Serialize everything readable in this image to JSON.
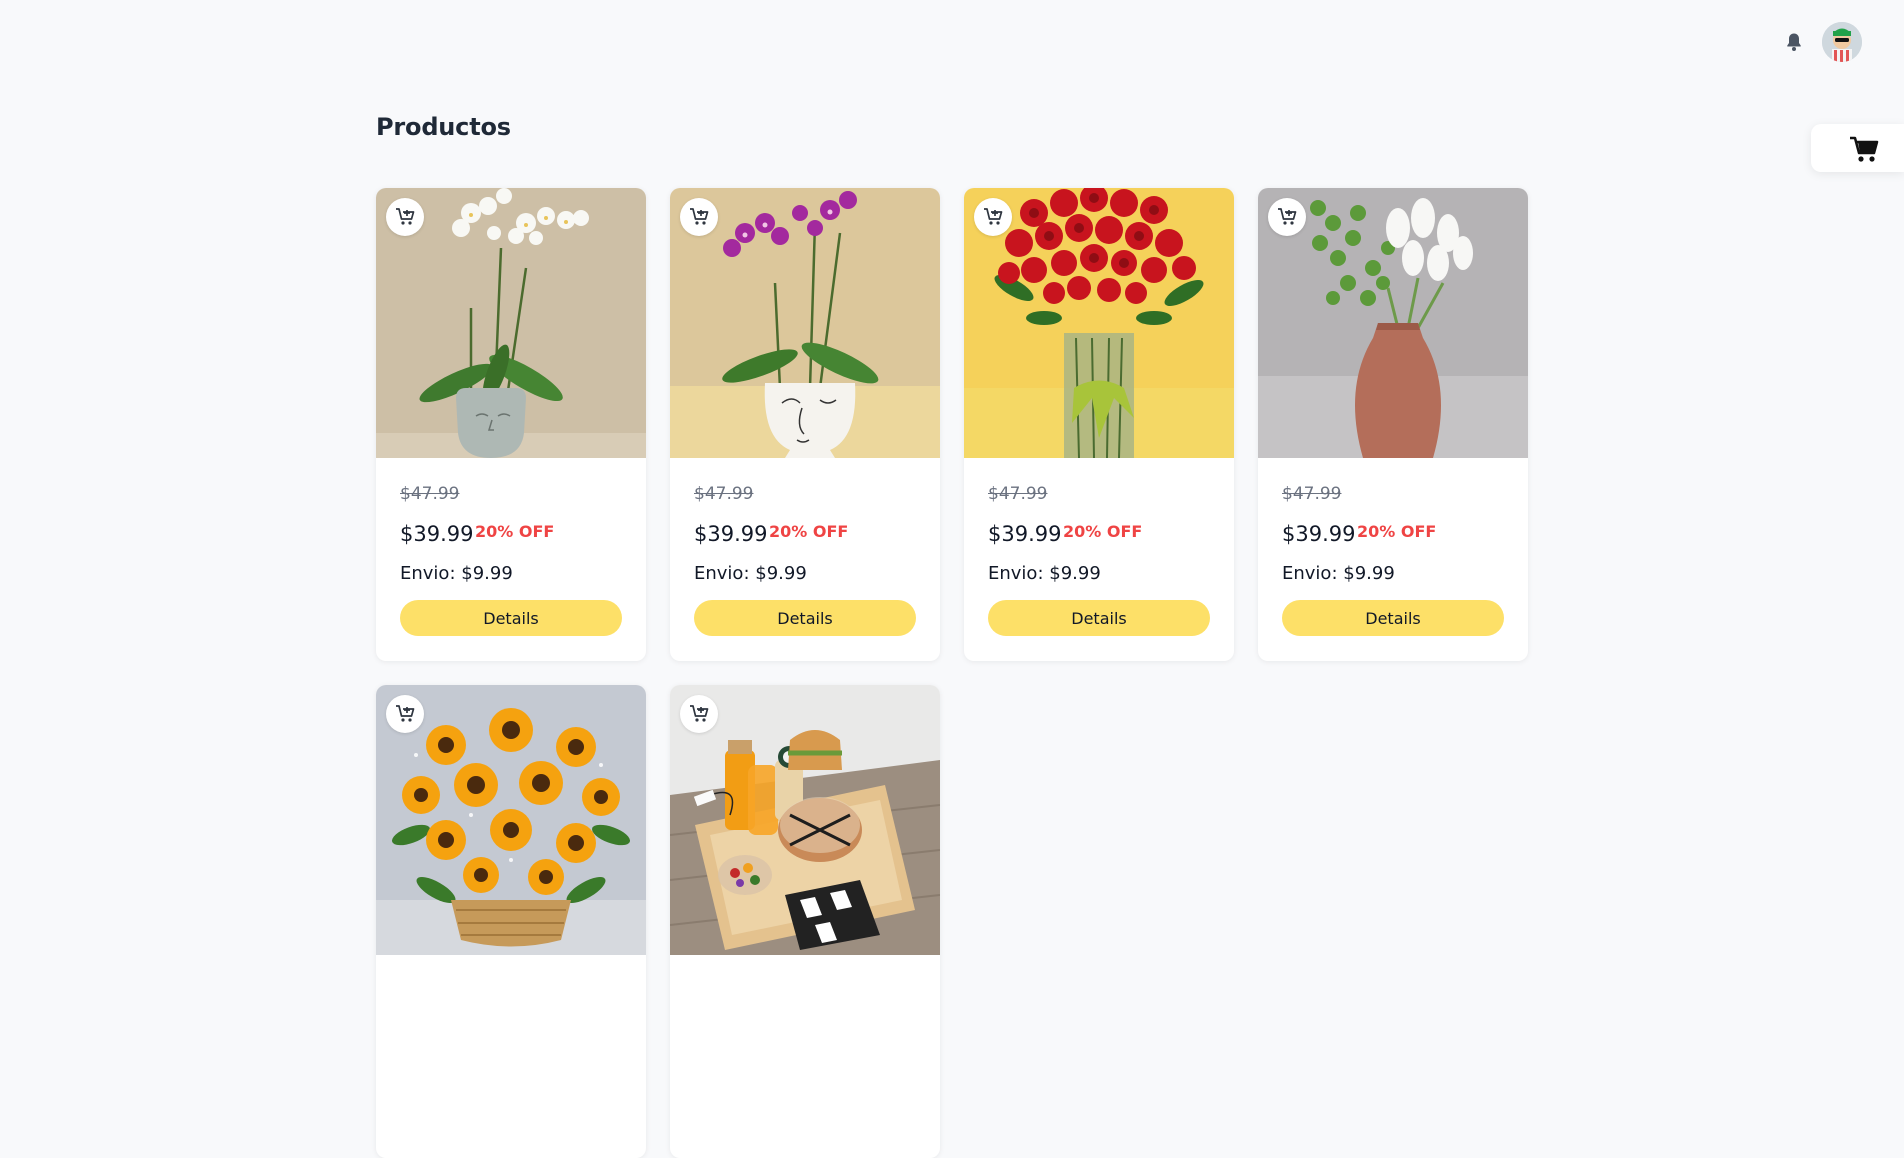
{
  "header": {
    "icons": [
      "bell-icon",
      "avatar",
      "cart-icon"
    ]
  },
  "page": {
    "title": "Productos"
  },
  "products": [
    {
      "old_price": "$47.99",
      "price": "$39.99",
      "discount": "20% OFF",
      "shipping_label": "Envio:",
      "shipping": "$9.99",
      "button": "Details",
      "image": "white orchid in face pot"
    },
    {
      "old_price": "$47.99",
      "price": "$39.99",
      "discount": "20% OFF",
      "shipping_label": "Envio:",
      "shipping": "$9.99",
      "button": "Details",
      "image": "purple orchid in face pot"
    },
    {
      "old_price": "$47.99",
      "price": "$39.99",
      "discount": "20% OFF",
      "shipping_label": "Envio:",
      "shipping": "$9.99",
      "button": "Details",
      "image": "red roses in glass vase"
    },
    {
      "old_price": "$47.99",
      "price": "$39.99",
      "discount": "20% OFF",
      "shipping_label": "Envio:",
      "shipping": "$9.99",
      "button": "Details",
      "image": "white tulips in terracotta vase"
    },
    {
      "image": "sunflower basket"
    },
    {
      "image": "breakfast tray"
    }
  ],
  "colors": {
    "accent_button": "#fde068",
    "discount": "#ef4444",
    "background": "#f8f9fb"
  }
}
